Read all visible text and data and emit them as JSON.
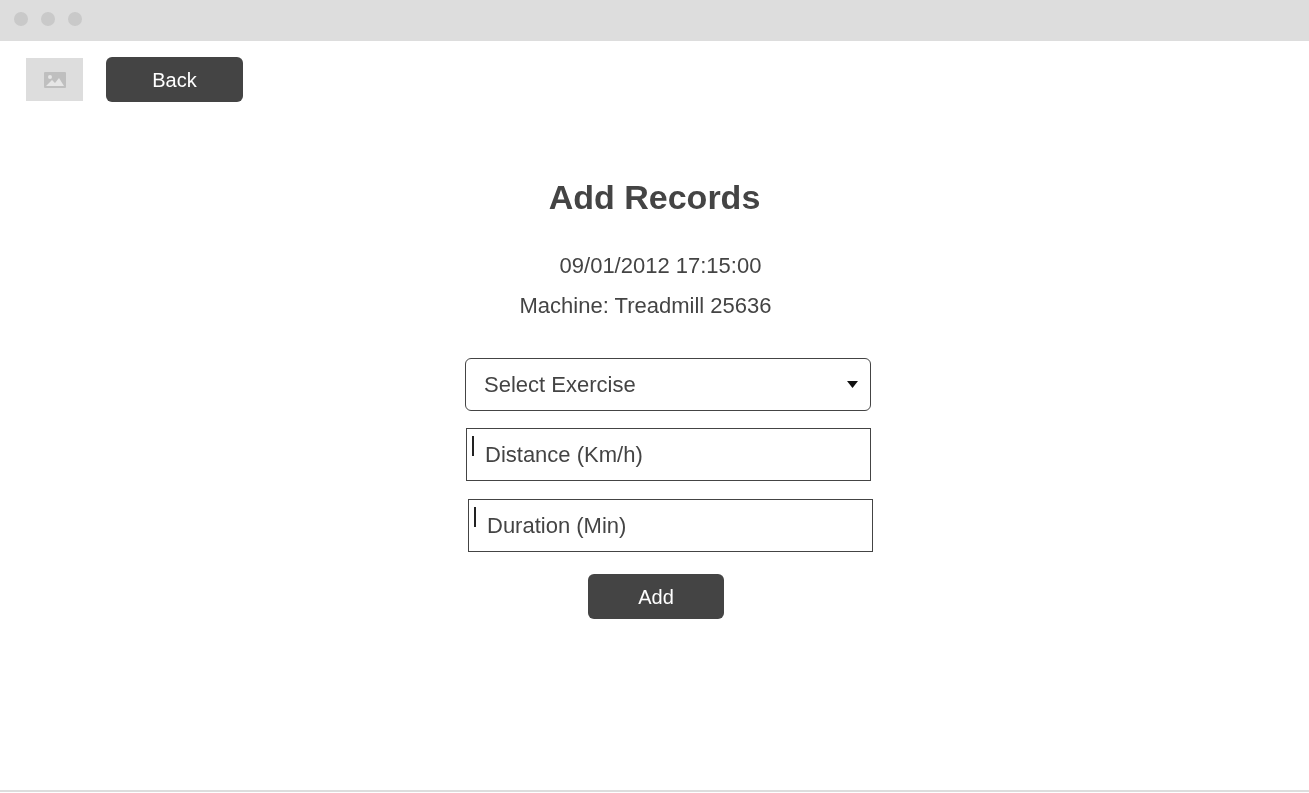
{
  "toolbar": {
    "back_button": "Back"
  },
  "form": {
    "title": "Add Records",
    "datetime": "09/01/2012 17:15:00",
    "machine": "Machine: Treadmill 25636",
    "exercise_select": {
      "placeholder": "Select Exercise"
    },
    "fields": [
      {
        "placeholder": "Distance (Km/h)"
      },
      {
        "placeholder": "Duration (Min)"
      }
    ],
    "submit_button": "Add"
  }
}
